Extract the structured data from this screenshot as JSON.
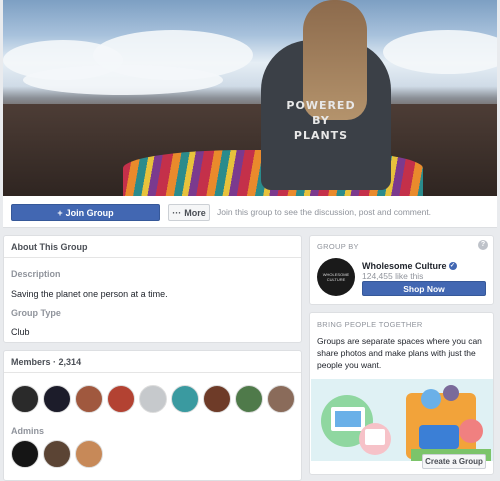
{
  "cover": {
    "shirt_line1": "POWERED",
    "shirt_line2": "BY",
    "shirt_line3": "PLANTS"
  },
  "actions": {
    "join_label": "Join Group",
    "join_icon": "plus-icon",
    "more_label": "More",
    "more_icon": "ellipsis-icon",
    "join_hint": "Join this group to see the discussion, post and comment."
  },
  "about": {
    "title": "About This Group",
    "description_label": "Description",
    "description": "Saving the planet one person at a time.",
    "type_label": "Group Type",
    "type": "Club"
  },
  "members": {
    "title": "Members",
    "separator": "·",
    "count": "2,314",
    "admins_label": "Admins",
    "member_avatars": 9,
    "admin_avatars": 3
  },
  "group_by": {
    "heading": "GROUP BY",
    "help_icon": "question-icon",
    "logo_line1": "WHOLESOME",
    "logo_line2": "CULTURE",
    "name": "Wholesome Culture",
    "verified_icon": "verified-badge-icon",
    "likes": "124,455 like this",
    "shop_label": "Shop Now"
  },
  "bring": {
    "heading": "BRING PEOPLE TOGETHER",
    "description": "Groups are separate spaces where you can share photos and make plans with just the people you want.",
    "create_label": "Create a Group"
  },
  "colors": {
    "brand_blue": "#4267b2",
    "page_bg": "#e9ebee",
    "muted_text": "#90949c"
  }
}
